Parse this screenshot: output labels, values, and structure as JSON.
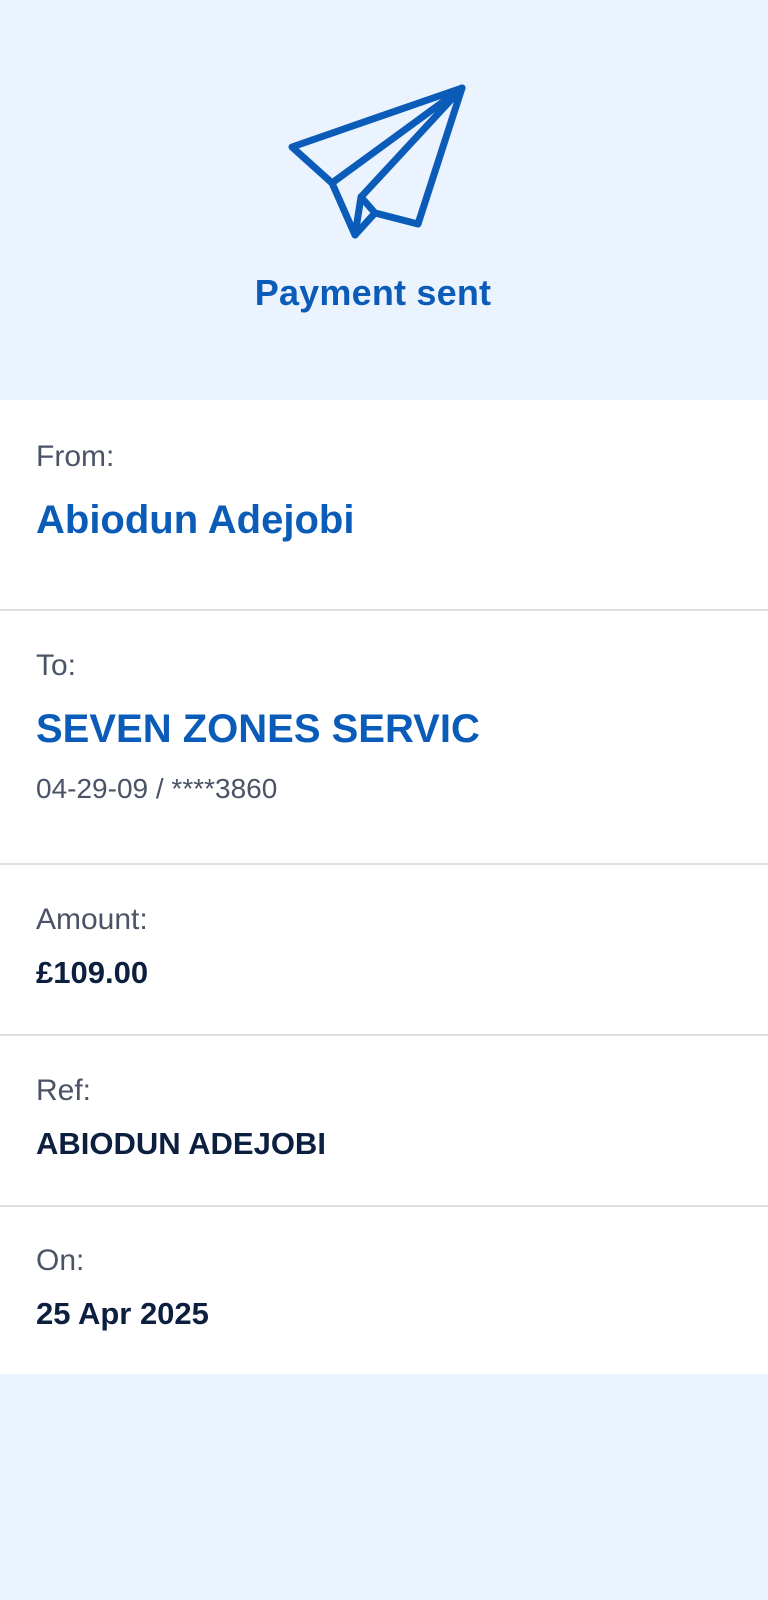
{
  "header": {
    "title": "Payment sent",
    "icon": "paper-plane-icon",
    "accent_color": "#0b5cb8",
    "background_color": "#eaf3fe"
  },
  "details": {
    "from": {
      "label": "From:",
      "name": "Abiodun Adejobi"
    },
    "to": {
      "label": "To:",
      "name": "SEVEN ZONES SERVIC",
      "account": "04-29-09 / ****3860"
    },
    "amount": {
      "label": "Amount:",
      "value": "£109.00"
    },
    "ref": {
      "label": "Ref:",
      "value": "ABIODUN ADEJOBI"
    },
    "on": {
      "label": "On:",
      "value": "25 Apr 2025"
    }
  }
}
